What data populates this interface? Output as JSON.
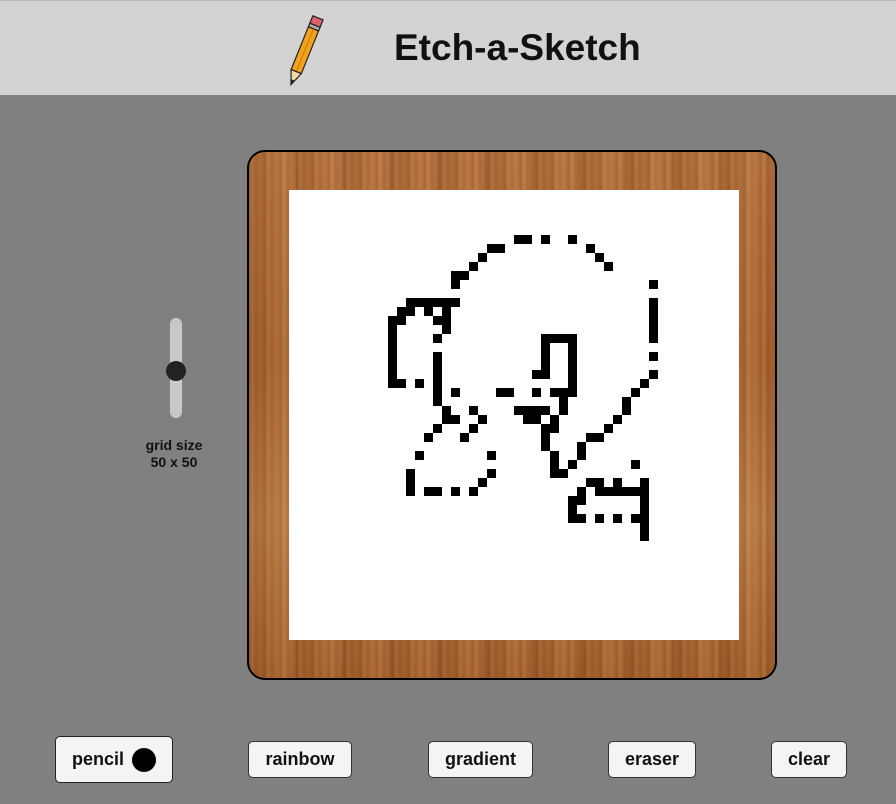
{
  "header": {
    "title": "Etch-a-Sketch",
    "logo_icon": "pencil-icon"
  },
  "controls": {
    "grid_size_label": "grid size",
    "grid_size_value": "50 x 50",
    "grid_size": 50,
    "slider_fraction": 0.54
  },
  "toolbar": {
    "pencil_label": "pencil",
    "rainbow_label": "rainbow",
    "gradient_label": "gradient",
    "eraser_label": "eraser",
    "clear_label": "clear",
    "active_mode": "pencil",
    "pencil_color": "#000000"
  },
  "colors": {
    "background": "#808080",
    "header": "#d3d3d3",
    "frame_wood": "#a8642f",
    "canvas": "#ffffff",
    "ink": "#000000"
  },
  "drawing": {
    "cells": [
      [
        25,
        5
      ],
      [
        26,
        5
      ],
      [
        28,
        5
      ],
      [
        31,
        5
      ],
      [
        22,
        6
      ],
      [
        23,
        6
      ],
      [
        33,
        6
      ],
      [
        21,
        7
      ],
      [
        34,
        7
      ],
      [
        20,
        8
      ],
      [
        35,
        8
      ],
      [
        18,
        9
      ],
      [
        19,
        9
      ],
      [
        18,
        10
      ],
      [
        40,
        10
      ],
      [
        13,
        12
      ],
      [
        14,
        12
      ],
      [
        15,
        12
      ],
      [
        16,
        12
      ],
      [
        17,
        12
      ],
      [
        18,
        12
      ],
      [
        40,
        12
      ],
      [
        12,
        13
      ],
      [
        13,
        13
      ],
      [
        15,
        13
      ],
      [
        17,
        13
      ],
      [
        40,
        13
      ],
      [
        11,
        14
      ],
      [
        12,
        14
      ],
      [
        16,
        14
      ],
      [
        17,
        14
      ],
      [
        40,
        14
      ],
      [
        11,
        15
      ],
      [
        17,
        15
      ],
      [
        40,
        15
      ],
      [
        11,
        16
      ],
      [
        16,
        16
      ],
      [
        28,
        16
      ],
      [
        29,
        16
      ],
      [
        30,
        16
      ],
      [
        31,
        16
      ],
      [
        40,
        16
      ],
      [
        11,
        17
      ],
      [
        28,
        17
      ],
      [
        31,
        17
      ],
      [
        11,
        18
      ],
      [
        16,
        18
      ],
      [
        28,
        18
      ],
      [
        31,
        18
      ],
      [
        40,
        18
      ],
      [
        11,
        19
      ],
      [
        16,
        19
      ],
      [
        28,
        19
      ],
      [
        31,
        19
      ],
      [
        11,
        20
      ],
      [
        16,
        20
      ],
      [
        27,
        20
      ],
      [
        28,
        20
      ],
      [
        31,
        20
      ],
      [
        40,
        20
      ],
      [
        11,
        21
      ],
      [
        12,
        21
      ],
      [
        14,
        21
      ],
      [
        16,
        21
      ],
      [
        31,
        21
      ],
      [
        39,
        21
      ],
      [
        16,
        22
      ],
      [
        18,
        22
      ],
      [
        23,
        22
      ],
      [
        24,
        22
      ],
      [
        27,
        22
      ],
      [
        29,
        22
      ],
      [
        30,
        22
      ],
      [
        31,
        22
      ],
      [
        38,
        22
      ],
      [
        16,
        23
      ],
      [
        30,
        23
      ],
      [
        37,
        23
      ],
      [
        17,
        24
      ],
      [
        20,
        24
      ],
      [
        25,
        24
      ],
      [
        26,
        24
      ],
      [
        27,
        24
      ],
      [
        28,
        24
      ],
      [
        30,
        24
      ],
      [
        37,
        24
      ],
      [
        17,
        25
      ],
      [
        18,
        25
      ],
      [
        21,
        25
      ],
      [
        26,
        25
      ],
      [
        27,
        25
      ],
      [
        29,
        25
      ],
      [
        36,
        25
      ],
      [
        16,
        26
      ],
      [
        20,
        26
      ],
      [
        28,
        26
      ],
      [
        29,
        26
      ],
      [
        35,
        26
      ],
      [
        15,
        27
      ],
      [
        19,
        27
      ],
      [
        28,
        27
      ],
      [
        33,
        27
      ],
      [
        34,
        27
      ],
      [
        28,
        28
      ],
      [
        32,
        28
      ],
      [
        14,
        29
      ],
      [
        22,
        29
      ],
      [
        29,
        29
      ],
      [
        32,
        29
      ],
      [
        29,
        30
      ],
      [
        31,
        30
      ],
      [
        38,
        30
      ],
      [
        13,
        31
      ],
      [
        22,
        31
      ],
      [
        29,
        31
      ],
      [
        30,
        31
      ],
      [
        13,
        32
      ],
      [
        21,
        32
      ],
      [
        33,
        32
      ],
      [
        34,
        32
      ],
      [
        36,
        32
      ],
      [
        39,
        32
      ],
      [
        13,
        33
      ],
      [
        15,
        33
      ],
      [
        16,
        33
      ],
      [
        18,
        33
      ],
      [
        20,
        33
      ],
      [
        32,
        33
      ],
      [
        34,
        33
      ],
      [
        35,
        33
      ],
      [
        36,
        33
      ],
      [
        37,
        33
      ],
      [
        38,
        33
      ],
      [
        39,
        33
      ],
      [
        31,
        34
      ],
      [
        32,
        34
      ],
      [
        39,
        34
      ],
      [
        31,
        35
      ],
      [
        39,
        35
      ],
      [
        31,
        36
      ],
      [
        32,
        36
      ],
      [
        34,
        36
      ],
      [
        36,
        36
      ],
      [
        38,
        36
      ],
      [
        39,
        36
      ],
      [
        39,
        37
      ],
      [
        39,
        38
      ]
    ]
  }
}
